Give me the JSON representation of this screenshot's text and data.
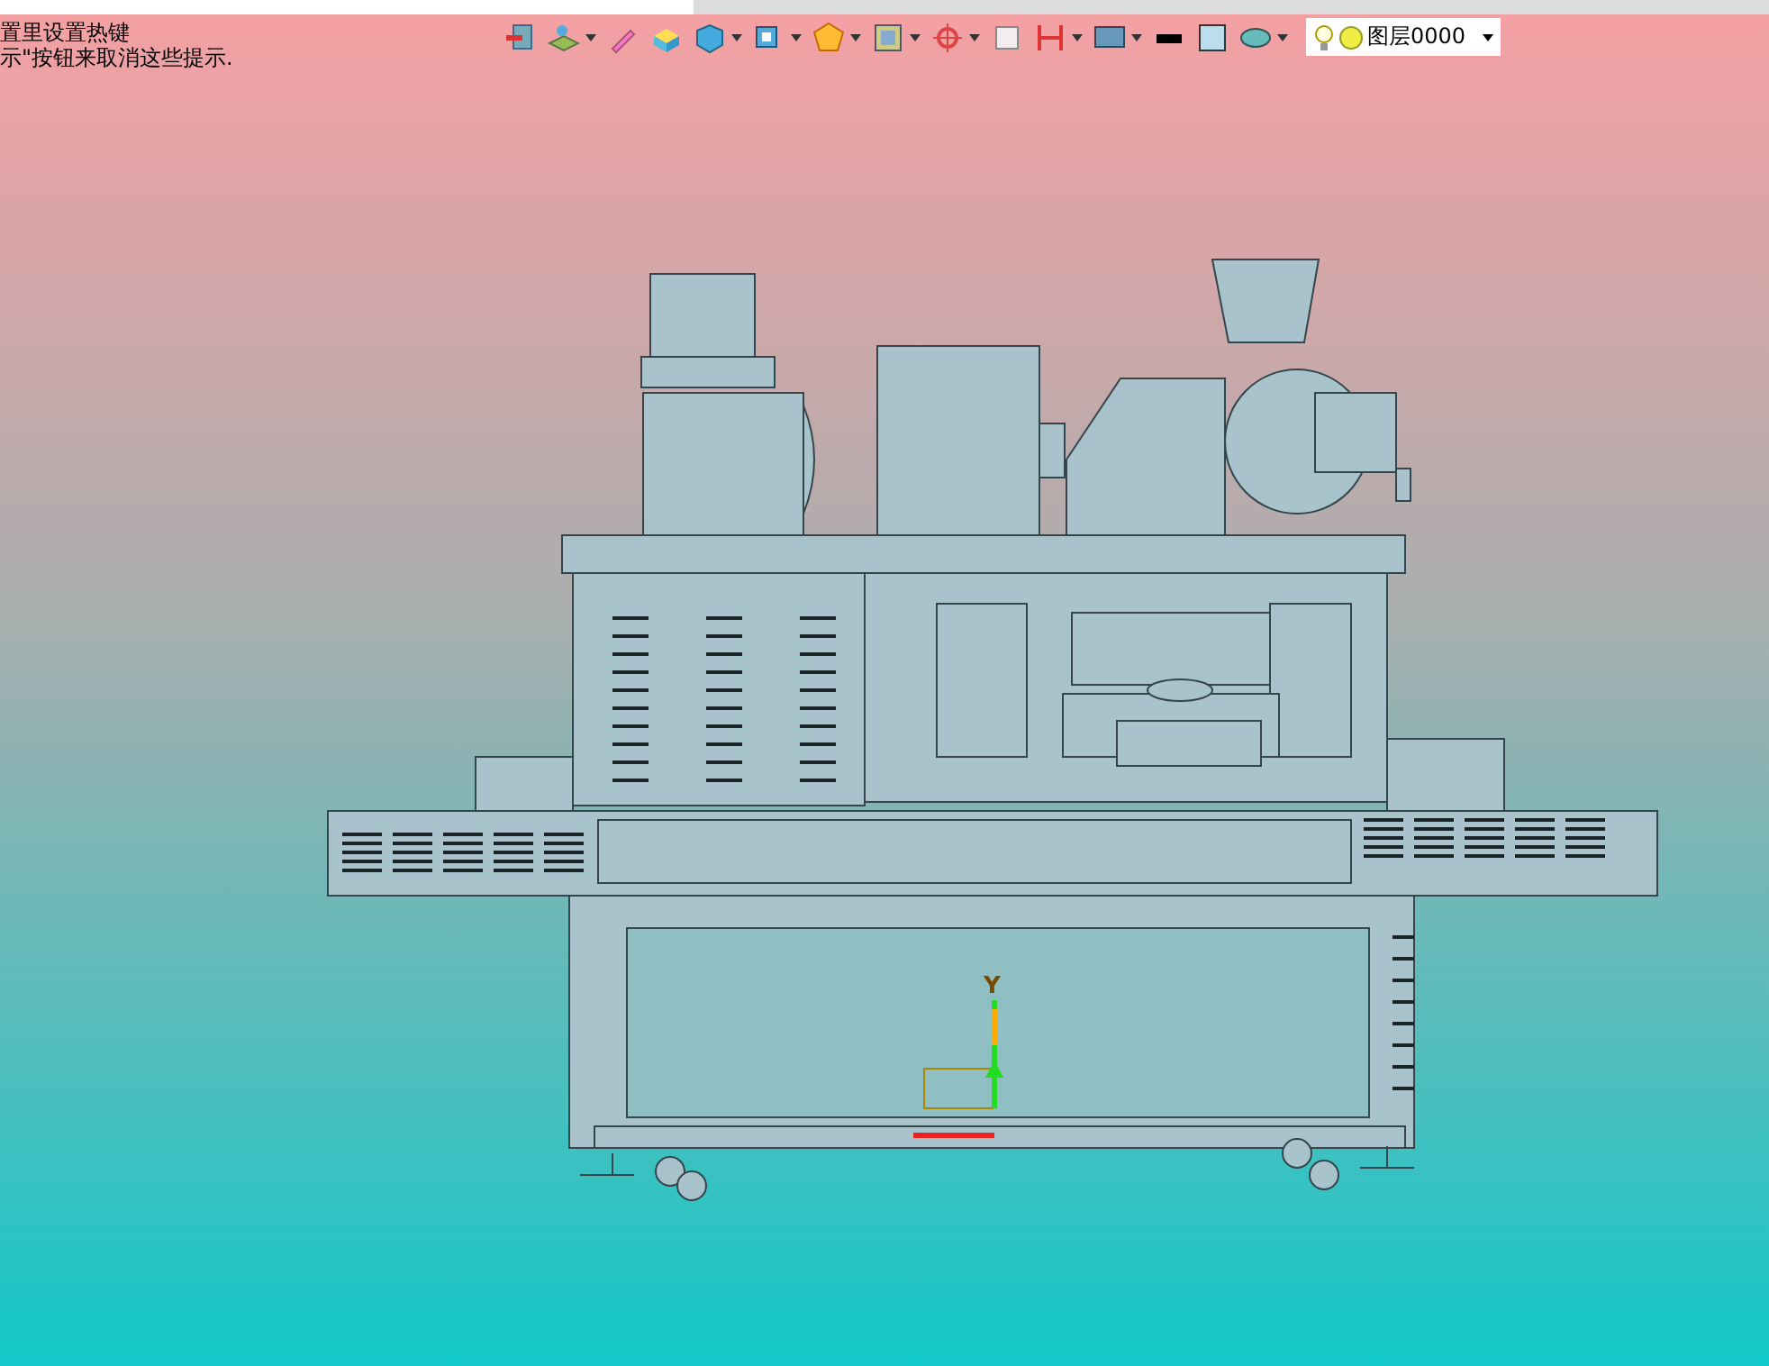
{
  "hints": [
    "置里设置热键",
    "示\"按钮来取消这些提示."
  ],
  "toolbar": {
    "layer": {
      "value": "图层0000"
    }
  },
  "viewport": {
    "axis_label": "Y"
  }
}
